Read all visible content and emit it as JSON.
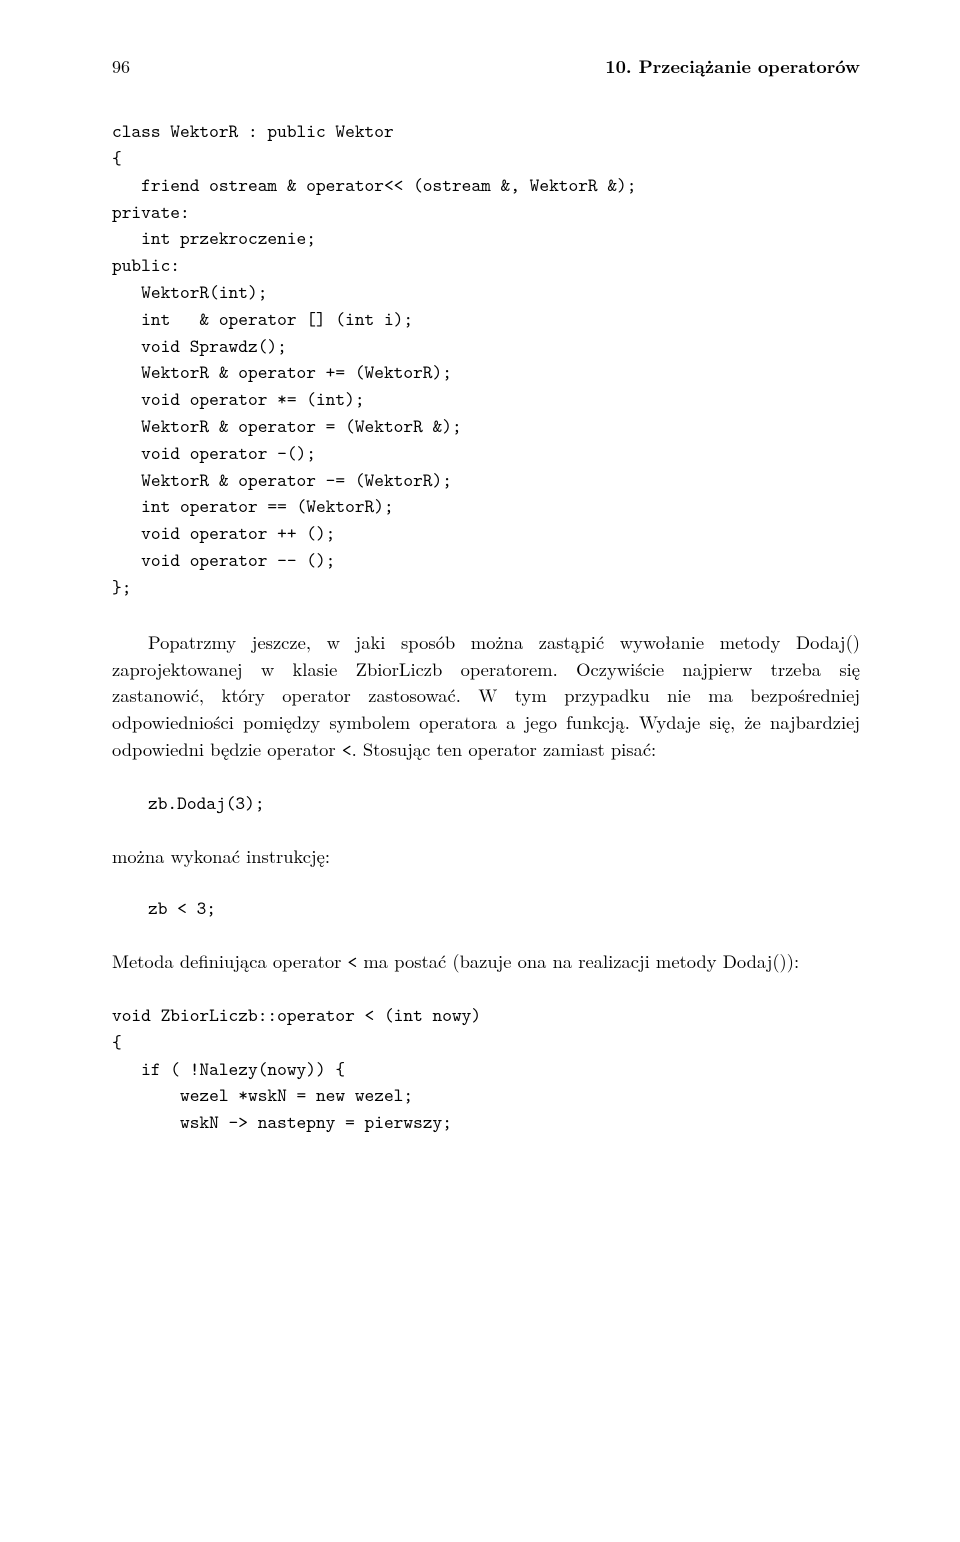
{
  "header": {
    "page_number": "96",
    "chapter_title": "10. Przeciążanie operatorów"
  },
  "code_block_1": "class WektorR : public Wektor\n{\n   friend ostream & operator<< (ostream &, WektorR &);\nprivate:\n   int przekroczenie;\npublic:\n   WektorR(int);\n   int   & operator [] (int i);\n   void Sprawdz();\n   WektorR & operator += (WektorR);\n   void operator *= (int);\n   WektorR & operator = (WektorR &);\n   void operator -();\n   WektorR & operator -= (WektorR);\n   int operator == (WektorR);\n   void operator ++ ();\n   void operator -- ();\n};",
  "paragraph_1": {
    "text_before_code1": "Popatrzmy jeszcze, w jaki sposób można zastąpić wywołanie metody Dodaj() zaprojektowanej w klasie ZbiorLiczb operatorem. Oczywiście najpierw trzeba się zastanowić, który operator zastosować. W tym przypadku nie ma bezpośredniej odpowiedniości pomiędzy symbolem operatora a jego funkcją. Wydaje się, że najbardziej odpowiedni będzie operator ",
    "inline_code1": "<",
    "text_after_code1": ". Stosując ten operator zamiast pisać:"
  },
  "code_line_1": "zb.Dodaj(3);",
  "paragraph_2": "można wykonać instrukcję:",
  "code_line_2": "zb < 3;",
  "paragraph_3": {
    "text_before": "Metoda definiująca operator ",
    "inline_code": "<",
    "text_after": " ma postać (bazuje ona na realizacji metody Dodaj()):"
  },
  "code_block_2": "void ZbiorLiczb::operator < (int nowy)\n{\n   if ( !Nalezy(nowy)) {\n       wezel *wskN = new wezel;\n       wskN -> nastepny = pierwszy;"
}
